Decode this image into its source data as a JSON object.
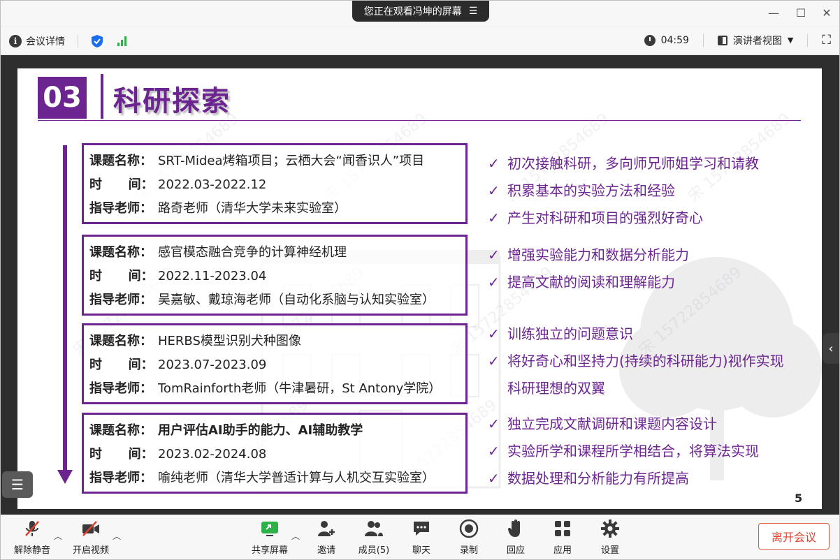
{
  "topbar": {
    "share_notice": "您正在观看冯坤的屏幕",
    "meeting_details": "会议详情",
    "timer": "04:59",
    "view_mode": "演讲者视图"
  },
  "slide": {
    "number": "03",
    "title": "科研探索",
    "page": "5",
    "projects": [
      {
        "name_label": "课题名称：",
        "name": "SRT-Midea烤箱项目；云栖大会“闻香识人”项目",
        "time_label": "时      间：",
        "time": "2022.03-2022.12",
        "advisor_label": "指导老师：",
        "advisor": "路奇老师（清华大学未来实验室）"
      },
      {
        "name_label": "课题名称：",
        "name": "感官模态融合竞争的计算神经机理",
        "time_label": "时      间：",
        "time": "2022.11-2023.04",
        "advisor_label": "指导老师：",
        "advisor": "吴嘉敏、戴琼海老师（自动化系脑与认知实验室）"
      },
      {
        "name_label": "课题名称：",
        "name": "HERBS模型识别犬种图像",
        "time_label": "时      间：",
        "time": "2023.07-2023.09",
        "advisor_label": "指导老师：",
        "advisor": "TomRainforth老师（牛津暑研，St Antony学院）"
      },
      {
        "name_label": "课题名称：",
        "name": "用户评估AI助手的能力、AI辅助教学",
        "time_label": "时      间：",
        "time": "2023.02-2024.08",
        "advisor_label": "指导老师：",
        "advisor": "喻纯老师（清华大学普适计算与人机交互实验室）"
      }
    ],
    "points": [
      [
        "初次接触科研，多向师兄师姐学习和请教",
        "积累基本的实验方法和经验",
        "产生对科研和项目的强烈好奇心"
      ],
      [
        "增强实验能力和数据分析能力",
        "提高文献的阅读和理解能力"
      ],
      [
        "训练独立的问题意识",
        "将好奇心和坚持力(持续的科研能力)视作实现",
        "科研理想的双翼"
      ],
      [
        "独立完成文献调研和课题内容设计",
        "实验所学和课程所学相结合，将算法实现",
        "数据处理和分析能力有所提高"
      ]
    ],
    "check": "✓",
    "watermark": "宋 15722854689"
  },
  "toolbar": {
    "mute": "解除静音",
    "video": "开启视频",
    "share": "共享屏幕",
    "invite": "邀请",
    "members": "成员(5)",
    "chat": "聊天",
    "record": "录制",
    "react": "回应",
    "apps": "应用",
    "settings": "设置",
    "leave": "离开会议"
  }
}
